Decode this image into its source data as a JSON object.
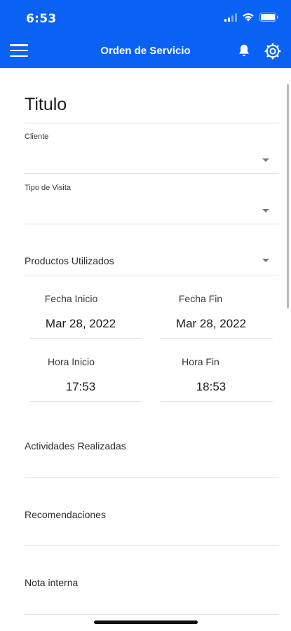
{
  "status_bar": {
    "time": "6:53"
  },
  "app_bar": {
    "title": "Orden de Servicio"
  },
  "form": {
    "title": "Titulo",
    "cliente_label": "Cliente",
    "tipo_visita_label": "Tipo de Visita",
    "productos_label": "Productos Utilizados",
    "fecha_inicio_label": "Fecha Inicio",
    "fecha_inicio_value": "Mar 28, 2022",
    "fecha_fin_label": "Fecha Fin",
    "fecha_fin_value": "Mar 28, 2022",
    "hora_inicio_label": "Hora Inicio",
    "hora_inicio_value": "17:53",
    "hora_fin_label": "Hora Fin",
    "hora_fin_value": "18:53",
    "actividades_label": "Actividades Realizadas",
    "recomendaciones_label": "Recomendaciones",
    "nota_label": "Nota interna"
  },
  "colors": {
    "accent": "#0a62f5"
  }
}
